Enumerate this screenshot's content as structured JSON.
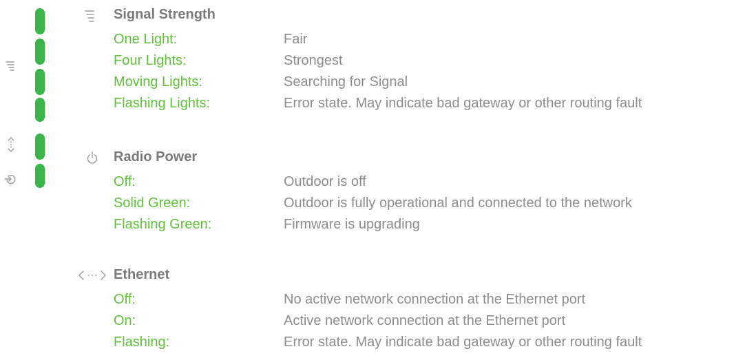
{
  "colors": {
    "accent_green": "#5fc23a",
    "led_green": "#3ab54a",
    "heading_gray": "#7a7a7a",
    "desc_gray": "#8c8c8c",
    "icon_gray": "#9a9a9a"
  },
  "icons": {
    "signal_strength": "signal-bars-icon",
    "radio_power": "power-icon",
    "ethernet": "ethernet-icon",
    "side_signal": "signal-bars-icon",
    "side_transfer": "data-transfer-icon",
    "side_radio": "radio-power-icon"
  },
  "signal_strength": {
    "heading": "Signal Strength",
    "rows": [
      {
        "term": "One Light:",
        "desc": "Fair"
      },
      {
        "term": "Four Lights:",
        "desc": "Strongest"
      },
      {
        "term": "Moving Lights:",
        "desc": "Searching for Signal"
      },
      {
        "term": "Flashing Lights:",
        "desc": "Error state. May indicate bad gateway or other routing fault"
      }
    ]
  },
  "radio_power": {
    "heading": "Radio Power",
    "rows": [
      {
        "term": "Off:",
        "desc": "Outdoor is off"
      },
      {
        "term": "Solid Green:",
        "desc": "Outdoor is fully operational and connected to the network"
      },
      {
        "term": "Flashing Green:",
        "desc": "Firmware is upgrading"
      }
    ]
  },
  "ethernet": {
    "heading": "Ethernet",
    "rows": [
      {
        "term": "Off:",
        "desc": "No active network connection at the Ethernet port"
      },
      {
        "term": "On:",
        "desc": "Active network connection at the Ethernet port"
      },
      {
        "term": "Flashing:",
        "desc": "Error state. May indicate bad gateway or other routing fault"
      }
    ]
  }
}
